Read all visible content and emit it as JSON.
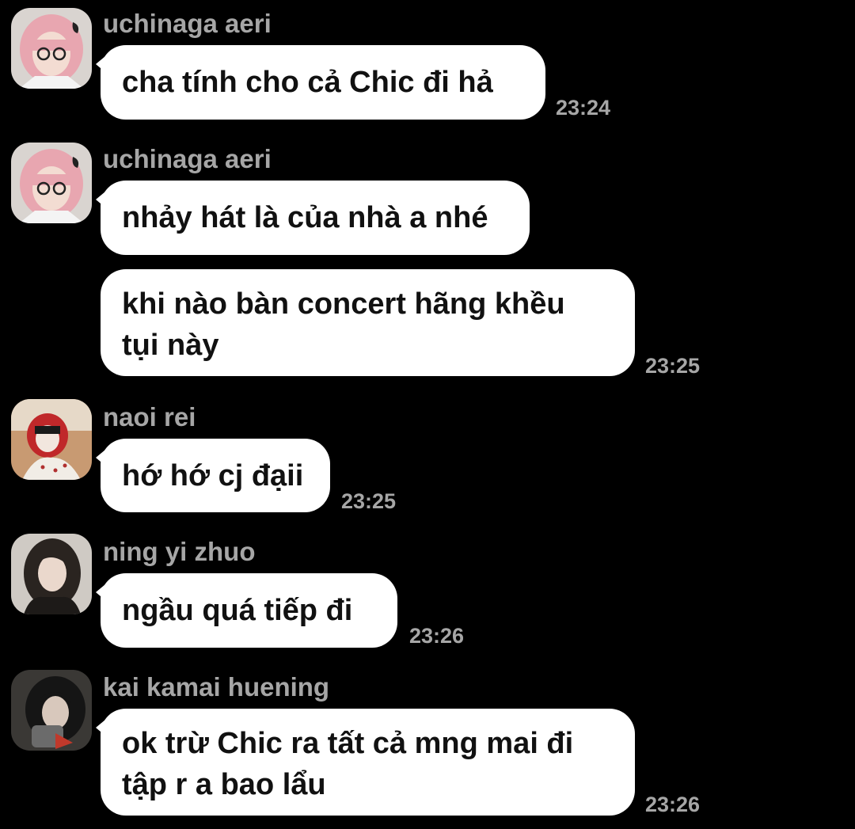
{
  "messages": [
    {
      "sender": "uchinaga aeri",
      "text": "cha tính cho cả Chic đi hả",
      "time": "23:24",
      "avatar": "avatar-pink-hair"
    },
    {
      "sender": "uchinaga aeri",
      "text": "nhảy hát là của nhà a nhé",
      "avatar": "avatar-pink-hair"
    },
    {
      "lines": [
        "khi nào bàn concert  hãng khều",
        "tụi này"
      ],
      "time": "23:25"
    },
    {
      "sender": "naoi rei",
      "text": "hớ hớ cj đạii",
      "time": "23:25",
      "avatar": "avatar-red-hood"
    },
    {
      "sender": "ning yi zhuo",
      "text": "ngầu quá tiếp đi",
      "time": "23:26",
      "avatar": "avatar-dark-hair"
    },
    {
      "sender": "kai kamai huening",
      "lines": [
        "ok trừ Chic ra tất cả mng mai đi",
        "tập r a bao lẩu"
      ],
      "time": "23:26",
      "avatar": "avatar-hooded"
    }
  ],
  "colors": {
    "background": "#000000",
    "bubble": "#ffffff",
    "bubble_text": "#111111",
    "meta_text": "#a6a6a6"
  }
}
